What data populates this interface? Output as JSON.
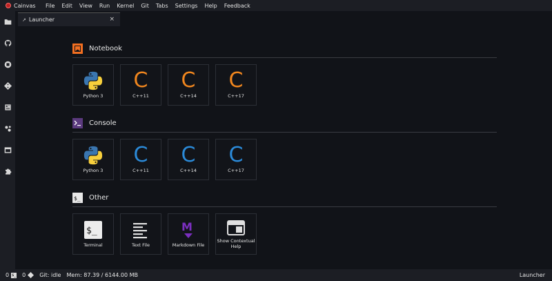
{
  "app": {
    "title": "Cainvas"
  },
  "menu": [
    "File",
    "Edit",
    "View",
    "Run",
    "Kernel",
    "Git",
    "Tabs",
    "Settings",
    "Help",
    "Feedback"
  ],
  "sidebar_icons": [
    "folder-icon",
    "github-icon",
    "running-icon",
    "git-icon",
    "property-inspector-icon",
    "extension-manager-icon",
    "tabs-icon",
    "puzzle-icon"
  ],
  "tab": {
    "label": "Launcher",
    "close": "×"
  },
  "sections": {
    "notebook": {
      "title": "Notebook",
      "items": [
        {
          "label": "Python 3",
          "icon": "python-icon"
        },
        {
          "label": "C++11",
          "icon": "c-icon",
          "color": "#f0861e"
        },
        {
          "label": "C++14",
          "icon": "c-icon",
          "color": "#f0861e"
        },
        {
          "label": "C++17",
          "icon": "c-icon",
          "color": "#f0861e"
        }
      ]
    },
    "console": {
      "title": "Console",
      "items": [
        {
          "label": "Python 3",
          "icon": "python-icon"
        },
        {
          "label": "C++11",
          "icon": "c-icon",
          "color": "#2b8ad8"
        },
        {
          "label": "C++14",
          "icon": "c-icon",
          "color": "#2b8ad8"
        },
        {
          "label": "C++17",
          "icon": "c-icon",
          "color": "#2b8ad8"
        }
      ]
    },
    "other": {
      "title": "Other",
      "items": [
        {
          "label": "Terminal",
          "icon": "terminal-icon"
        },
        {
          "label": "Text File",
          "icon": "text-file-icon"
        },
        {
          "label": "Markdown File",
          "icon": "markdown-icon"
        },
        {
          "label": "Show Contextual Help",
          "icon": "contextual-help-icon"
        }
      ]
    }
  },
  "statusbar": {
    "count_a": "0",
    "count_b": "0",
    "git": "Git: idle",
    "mem": "Mem: 87.39 / 6144.00 MB",
    "right": "Launcher"
  },
  "colors": {
    "notebook_accent": "#f26f21",
    "console_accent": "#6a3f8f",
    "markdown_purple": "#7b2fbf"
  }
}
